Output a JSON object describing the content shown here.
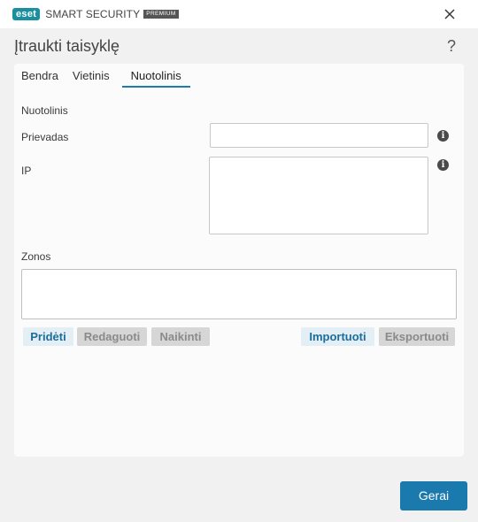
{
  "titlebar": {
    "logo_text": "eset",
    "product": "SMART SECURITY",
    "edition": "PREMIUM",
    "close_icon": "close-icon"
  },
  "dialog": {
    "title": "Įtraukti taisyklę",
    "help": "?"
  },
  "tabs": [
    {
      "label": "Bendra",
      "active": false
    },
    {
      "label": "Vietinis",
      "active": false
    },
    {
      "label": "Nuotolinis",
      "active": true
    }
  ],
  "remote": {
    "section": "Nuotolinis",
    "port_label": "Prievadas",
    "port_value": "",
    "ip_label": "IP",
    "ip_value": "",
    "info_icon": "i"
  },
  "zones": {
    "label": "Zonos",
    "items": []
  },
  "buttons": {
    "add": "Pridėti",
    "edit": "Redaguoti",
    "delete": "Naikinti",
    "import": "Importuoti",
    "export": "Eksportuoti"
  },
  "footer": {
    "ok": "Gerai"
  },
  "colors": {
    "accent": "#1a7aad",
    "brand": "#1a8fa0"
  }
}
